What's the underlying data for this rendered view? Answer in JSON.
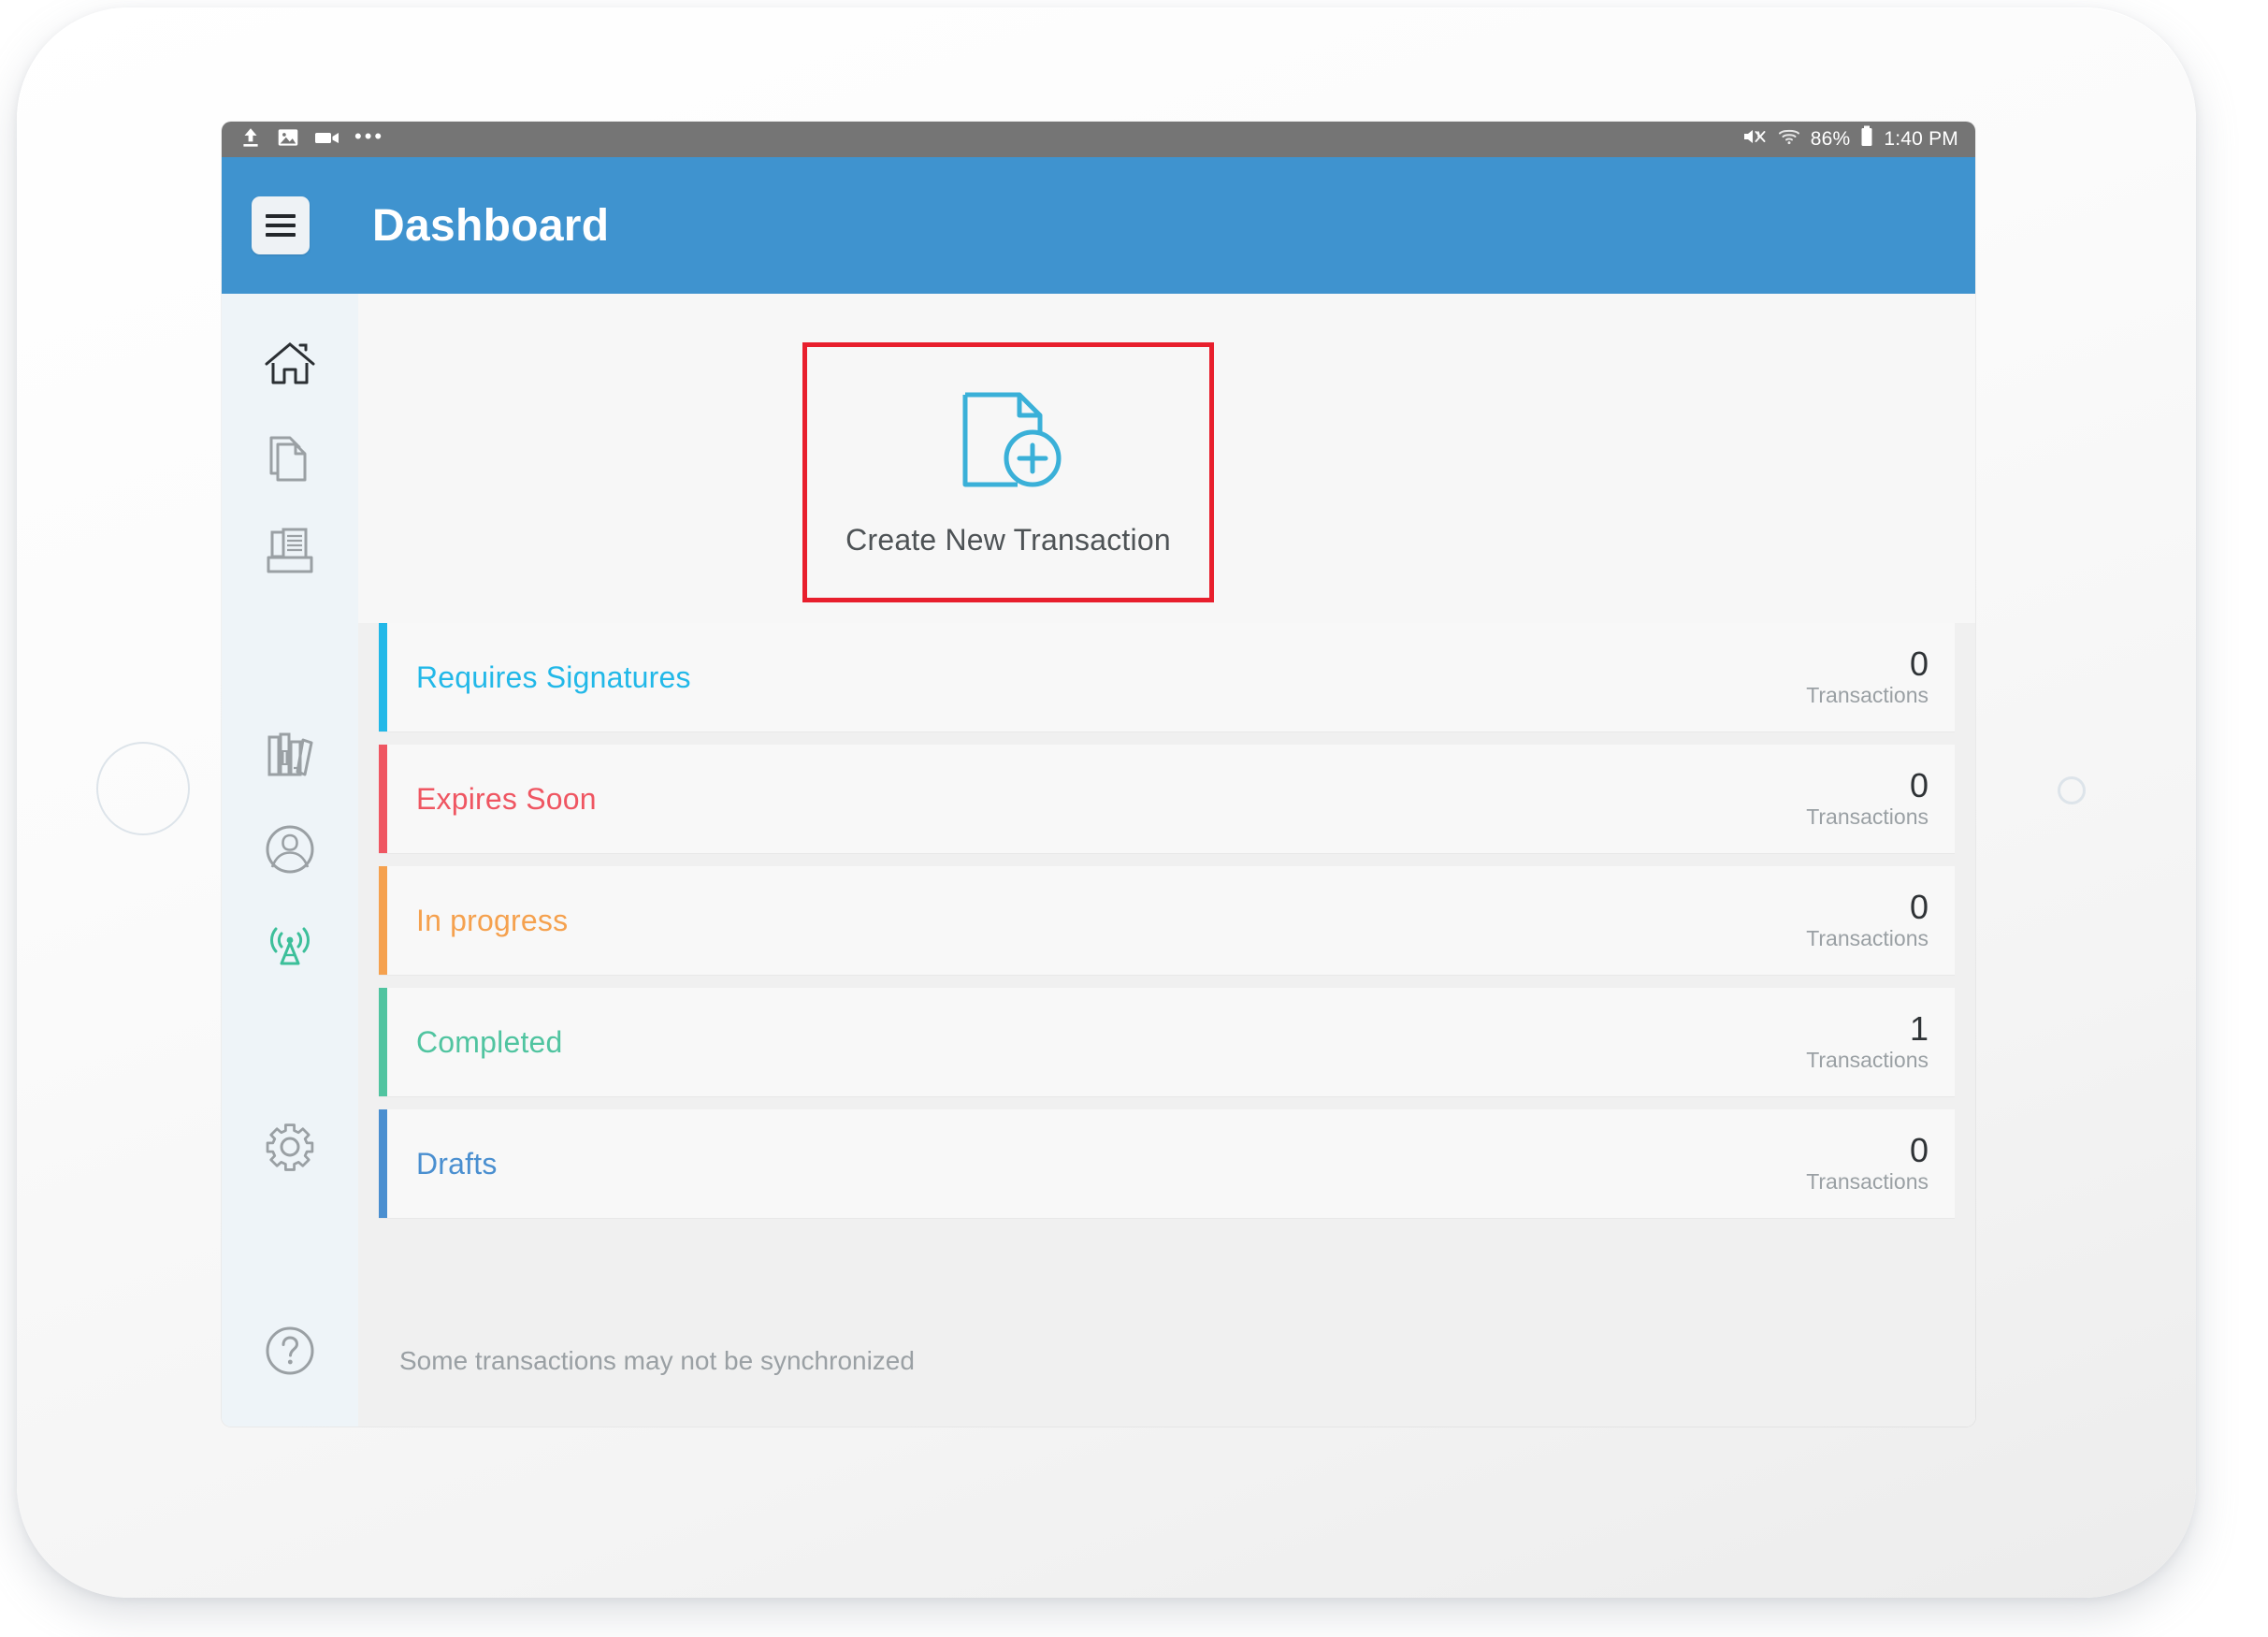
{
  "status_bar": {
    "left_icons": [
      "upload-icon",
      "image-icon",
      "video-icon"
    ],
    "ellipsis": "•••",
    "mute_icon": "volume-mute-icon",
    "wifi_icon": "wifi-icon",
    "battery_percent": "86%",
    "battery_icon": "battery-icon",
    "time": "1:40 PM"
  },
  "app_bar": {
    "menu_icon": "hamburger-menu-icon",
    "title": "Dashboard"
  },
  "sidebar": {
    "items": [
      {
        "name": "home",
        "icon": "home-icon",
        "active": true
      },
      {
        "name": "documents",
        "icon": "documents-copy-icon",
        "active": false
      },
      {
        "name": "inbox",
        "icon": "inbox-tray-document-icon",
        "active": false
      },
      {
        "name": "library",
        "icon": "books-library-icon",
        "active": false
      },
      {
        "name": "profile",
        "icon": "user-circle-icon",
        "active": false
      },
      {
        "name": "connection",
        "icon": "broadcast-antenna-icon",
        "active": false
      },
      {
        "name": "settings",
        "icon": "gear-icon",
        "active": false
      },
      {
        "name": "help",
        "icon": "question-circle-icon",
        "active": false
      }
    ]
  },
  "create_card": {
    "icon": "document-plus-icon",
    "label": "Create New Transaction",
    "highlight_color": "#e81f2d",
    "icon_color": "#3ab0d8"
  },
  "status_rows": [
    {
      "label": "Requires Signatures",
      "count": "0",
      "unit": "Transactions",
      "color": "#22b8e8"
    },
    {
      "label": "Expires Soon",
      "count": "0",
      "unit": "Transactions",
      "color": "#ef5662"
    },
    {
      "label": "In progress",
      "count": "0",
      "unit": "Transactions",
      "color": "#f5a14e"
    },
    {
      "label": "Completed",
      "count": "1",
      "unit": "Transactions",
      "color": "#50c4a0"
    },
    {
      "label": "Drafts",
      "count": "0",
      "unit": "Transactions",
      "color": "#4a8fd0"
    }
  ],
  "footer": {
    "sync_note": "Some transactions may not be synchronized"
  },
  "theme": {
    "app_bar_blue": "#3f93cf",
    "status_bar_grey": "#757575",
    "sidebar_bg": "#eef4f8",
    "content_bg": "#f7f7f7",
    "list_bg": "#f0f0f0"
  }
}
